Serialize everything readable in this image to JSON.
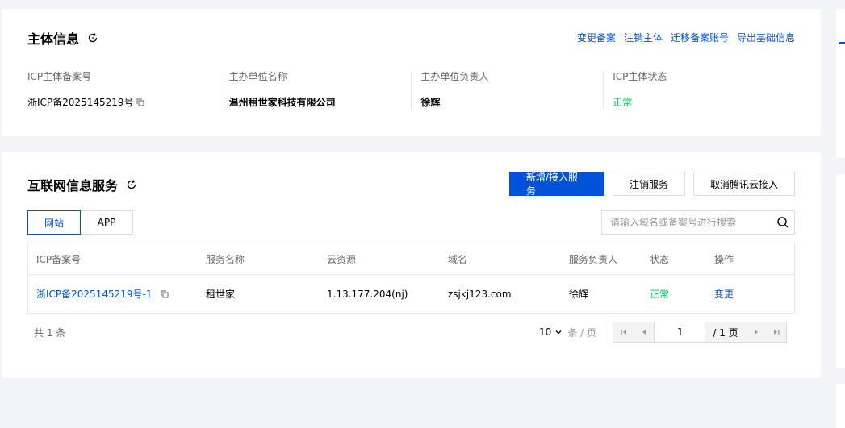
{
  "subject": {
    "title": "主体信息",
    "actions": [
      "变更备案",
      "注销主体",
      "迁移备案账号",
      "导出基础信息"
    ],
    "fields": [
      {
        "label": "ICP主体备案号",
        "value": "浙ICP备2025145219号"
      },
      {
        "label": "主办单位名称",
        "value": "温州租世家科技有限公司"
      },
      {
        "label": "主办单位负责人",
        "value": "徐辉"
      },
      {
        "label": "ICP主体状态",
        "value": "正常"
      }
    ]
  },
  "service": {
    "title": "互联网信息服务",
    "buttons": {
      "add": "新增/接入服务",
      "cancel_service": "注销服务",
      "cancel_access": "取消腾讯云接入"
    },
    "tabs": [
      "网站",
      "APP"
    ],
    "search_placeholder": "请输入域名或备案号进行搜索",
    "table": {
      "headers": [
        "ICP备案号",
        "服务名称",
        "云资源",
        "域名",
        "服务负责人",
        "状态",
        "操作"
      ],
      "rows": [
        {
          "icp": "浙ICP备2025145219号-1",
          "name": "租世家",
          "resource": "1.13.177.204(nj)",
          "domain": "zsjkj123.com",
          "owner": "徐辉",
          "status": "正常",
          "action": "变更"
        }
      ]
    },
    "footer": {
      "total": "共 1 条",
      "page_size": "10",
      "per_page_label": "条 / 页",
      "current_page": "1",
      "total_pages": "/ 1 页"
    }
  },
  "colors": {
    "primary": "#0052d9",
    "success": "#0abf5b",
    "muted": "#666666"
  },
  "icons": [
    "refresh-icon",
    "copy-icon",
    "search-icon",
    "chevron-down-icon",
    "first-page-icon",
    "prev-page-icon",
    "next-page-icon",
    "last-page-icon"
  ]
}
